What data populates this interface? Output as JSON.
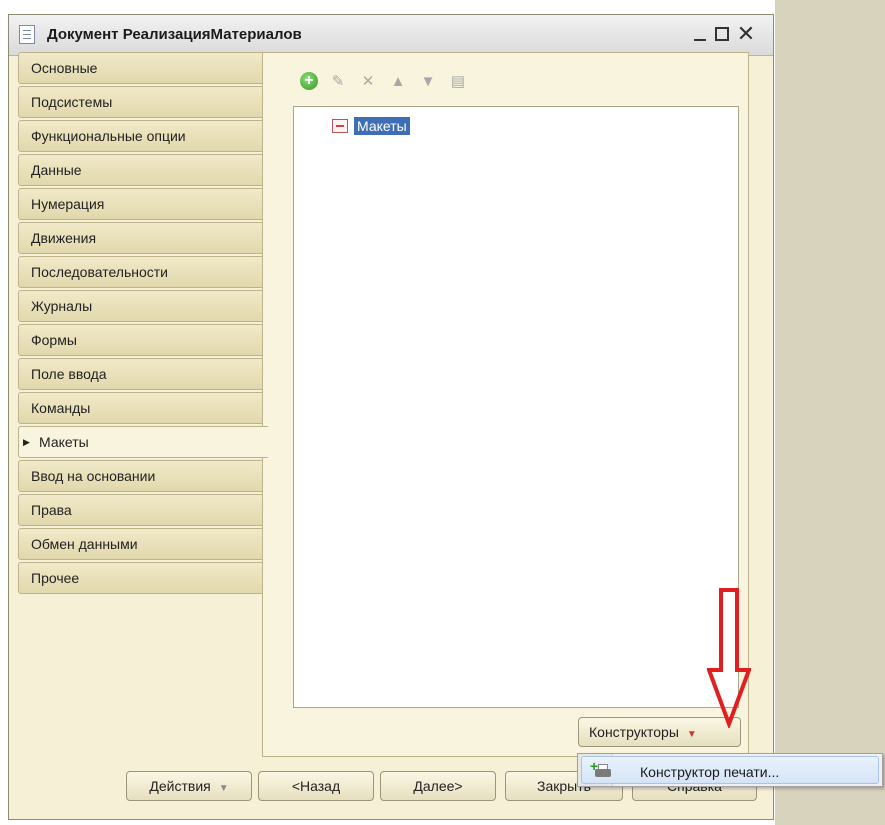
{
  "window": {
    "title": "Документ РеализацияМатериалов"
  },
  "tabs": [
    {
      "label": "Основные"
    },
    {
      "label": "Подсистемы"
    },
    {
      "label": "Функциональные опции"
    },
    {
      "label": "Данные"
    },
    {
      "label": "Нумерация"
    },
    {
      "label": "Движения"
    },
    {
      "label": "Последовательности"
    },
    {
      "label": "Журналы"
    },
    {
      "label": "Формы"
    },
    {
      "label": "Поле ввода"
    },
    {
      "label": "Команды"
    },
    {
      "label": "Макеты",
      "active": true
    },
    {
      "label": "Ввод на основании"
    },
    {
      "label": "Права"
    },
    {
      "label": "Обмен данными"
    },
    {
      "label": "Прочее"
    }
  ],
  "toolbar": {
    "icons": [
      "add-icon",
      "edit-icon",
      "delete-icon",
      "move-up-icon",
      "move-down-icon",
      "sort-icon"
    ]
  },
  "tree": {
    "items": [
      {
        "label": "Макеты",
        "selected": true
      }
    ]
  },
  "constructors_button": {
    "label": "Конструкторы"
  },
  "dropdown": {
    "items": [
      {
        "label": "Конструктор печати..."
      }
    ]
  },
  "footer": {
    "actions": "Действия",
    "back": "<Назад",
    "next": "Далее>",
    "close": "Закрыть",
    "help": "Справка"
  },
  "colors": {
    "window_bg": "#f6f1d6",
    "tab_bg": "#e6dcb2",
    "selection": "#3e6fb5",
    "annotation_arrow": "#e02020"
  }
}
